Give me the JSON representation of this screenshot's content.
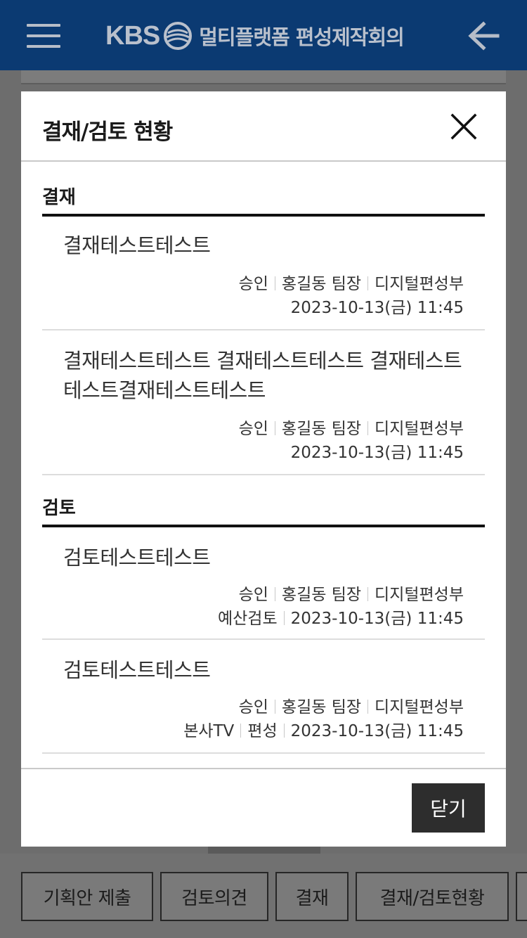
{
  "header": {
    "brand": "KBS",
    "title": "멀티플랫폼 편성제작회의"
  },
  "modal": {
    "title": "결재/검토 현황",
    "sections": {
      "approval": {
        "title": "결재",
        "items": [
          {
            "title": "결재테스트테스트",
            "status": "승인",
            "person": "홍길동 팀장",
            "dept": "디지털편성부",
            "datetime": "2023-10-13(금) 11:45"
          },
          {
            "title": "결재테스트테스트 결재테스트테스트 결재테스트테스트결재테스트테스트",
            "status": "승인",
            "person": "홍길동 팀장",
            "dept": "디지털편성부",
            "datetime": "2023-10-13(금) 11:45"
          }
        ]
      },
      "review": {
        "title": "검토",
        "items": [
          {
            "title": "검토테스트테스트",
            "status": "승인",
            "person": "홍길동 팀장",
            "dept": "디지털편성부",
            "type": "예산검토",
            "datetime": "2023-10-13(금) 11:45"
          },
          {
            "title": "검토테스트테스트",
            "status": "승인",
            "person": "홍길동 팀장",
            "dept": "디지털편성부",
            "channel": "본사TV",
            "type": "편성",
            "datetime": "2023-10-13(금) 11:45"
          }
        ]
      }
    },
    "close_label": "닫기"
  },
  "bottom_tabs": [
    "기획안 제출",
    "검토의견",
    "결재",
    "결재/검토현황"
  ],
  "colors": {
    "header_bg": "#0b3a72",
    "overlay": "#6d6d6d",
    "close_button_bg": "#2d2d2d"
  }
}
